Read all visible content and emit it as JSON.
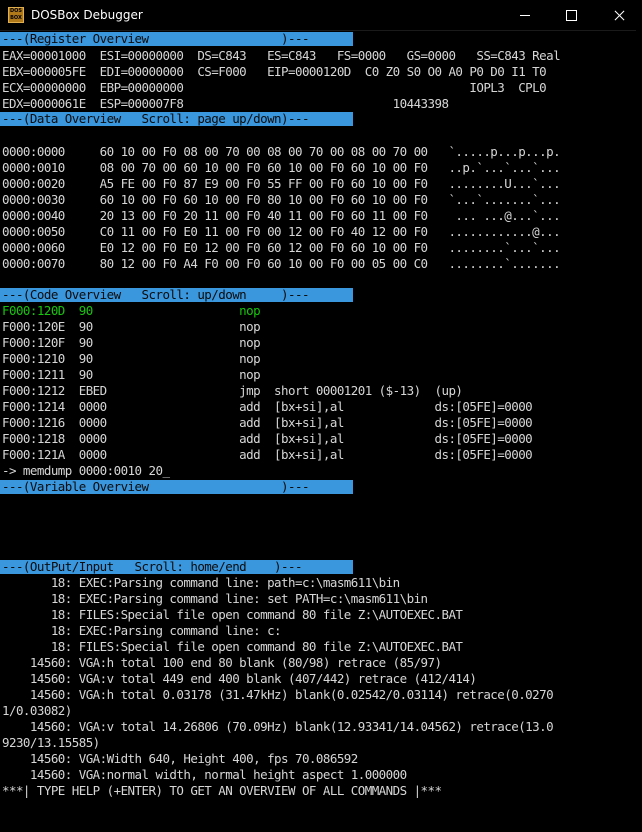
{
  "window": {
    "title": "DOSBox Debugger",
    "icon": "dosbox-icon",
    "icon_text": "DOS BOX"
  },
  "headers": {
    "register": "---(Register Overview                   )---",
    "data": "---(Data Overview   Scroll: page up/down)---",
    "code": "---(Code Overview   Scroll: up/down     )---",
    "variable": "---(Variable Overview                   )---",
    "output": "---(OutPut/Input   Scroll: home/end    )---"
  },
  "registers": [
    "EAX=00001000  ESI=00000000  DS=C843   ES=C843   FS=0000   GS=0000   SS=C843 Real",
    "EBX=000005FE  EDI=00000000  CS=F000   EIP=0000120D  C0 Z0 S0 O0 A0 P0 D0 I1 T0",
    "ECX=00000000  EBP=00000000                                         IOPL3  CPL0",
    "EDX=0000061E  ESP=000007F8                              10443398"
  ],
  "data_rows": [
    "0000:0000     60 10 00 F0 08 00 70 00 08 00 70 00 08 00 70 00   `.....p...p...p.",
    "0000:0010     08 00 70 00 60 10 00 F0 60 10 00 F0 60 10 00 F0   ..p.`...`...`...",
    "0000:0020     A5 FE 00 F0 87 E9 00 F0 55 FF 00 F0 60 10 00 F0   ........U...`...",
    "0000:0030     60 10 00 F0 60 10 00 F0 80 10 00 F0 60 10 00 F0   `...`.......`...",
    "0000:0040     20 13 00 F0 20 11 00 F0 40 11 00 F0 60 11 00 F0    ... ...@...`...",
    "0000:0050     C0 11 00 F0 E0 11 00 F0 00 12 00 F0 40 12 00 F0   ............@...",
    "0000:0060     E0 12 00 F0 E0 12 00 F0 60 12 00 F0 60 10 00 F0   ........`...`...",
    "0000:0070     80 12 00 F0 A4 F0 00 F0 60 10 00 F0 00 05 00 C0   ........`......."
  ],
  "code_rows": [
    "F000:120D  90                     nop",
    "F000:120E  90                     nop",
    "F000:120F  90                     nop",
    "F000:1210  90                     nop",
    "F000:1211  90                     nop",
    "F000:1212  EBED                   jmp  short 00001201 ($-13)  (up)",
    "F000:1214  0000                   add  [bx+si],al             ds:[05FE]=0000",
    "F000:1216  0000                   add  [bx+si],al             ds:[05FE]=0000",
    "F000:1218  0000                   add  [bx+si],al             ds:[05FE]=0000",
    "F000:121A  0000                   add  [bx+si],al             ds:[05FE]=0000"
  ],
  "command_input": "-> memdump 0000:0010 20_",
  "output_lines": [
    "       18: EXEC:Parsing command line: path=c:\\masm611\\bin",
    "       18: EXEC:Parsing command line: set PATH=c:\\masm611\\bin",
    "       18: FILES:Special file open command 80 file Z:\\AUTOEXEC.BAT",
    "       18: EXEC:Parsing command line: c:",
    "       18: FILES:Special file open command 80 file Z:\\AUTOEXEC.BAT",
    "    14560: VGA:h total 100 end 80 blank (80/98) retrace (85/97)",
    "    14560: VGA:v total 449 end 400 blank (407/442) retrace (412/414)",
    "    14560: VGA:h total 0.03178 (31.47kHz) blank(0.02542/0.03114) retrace(0.0270",
    "1/0.03082)",
    "    14560: VGA:v total 14.26806 (70.09Hz) blank(12.93341/14.04562) retrace(13.0",
    "9230/13.15585)",
    "    14560: VGA:Width 640, Height 400, fps 70.086592",
    "    14560: VGA:normal width, normal height aspect 1.000000",
    "***| TYPE HELP (+ENTER) TO GET AN OVERVIEW OF ALL COMMANDS |***"
  ],
  "colors": {
    "header_bg": "#3a96dd",
    "highlight": "#16c60c",
    "text": "#d6d6d6"
  }
}
